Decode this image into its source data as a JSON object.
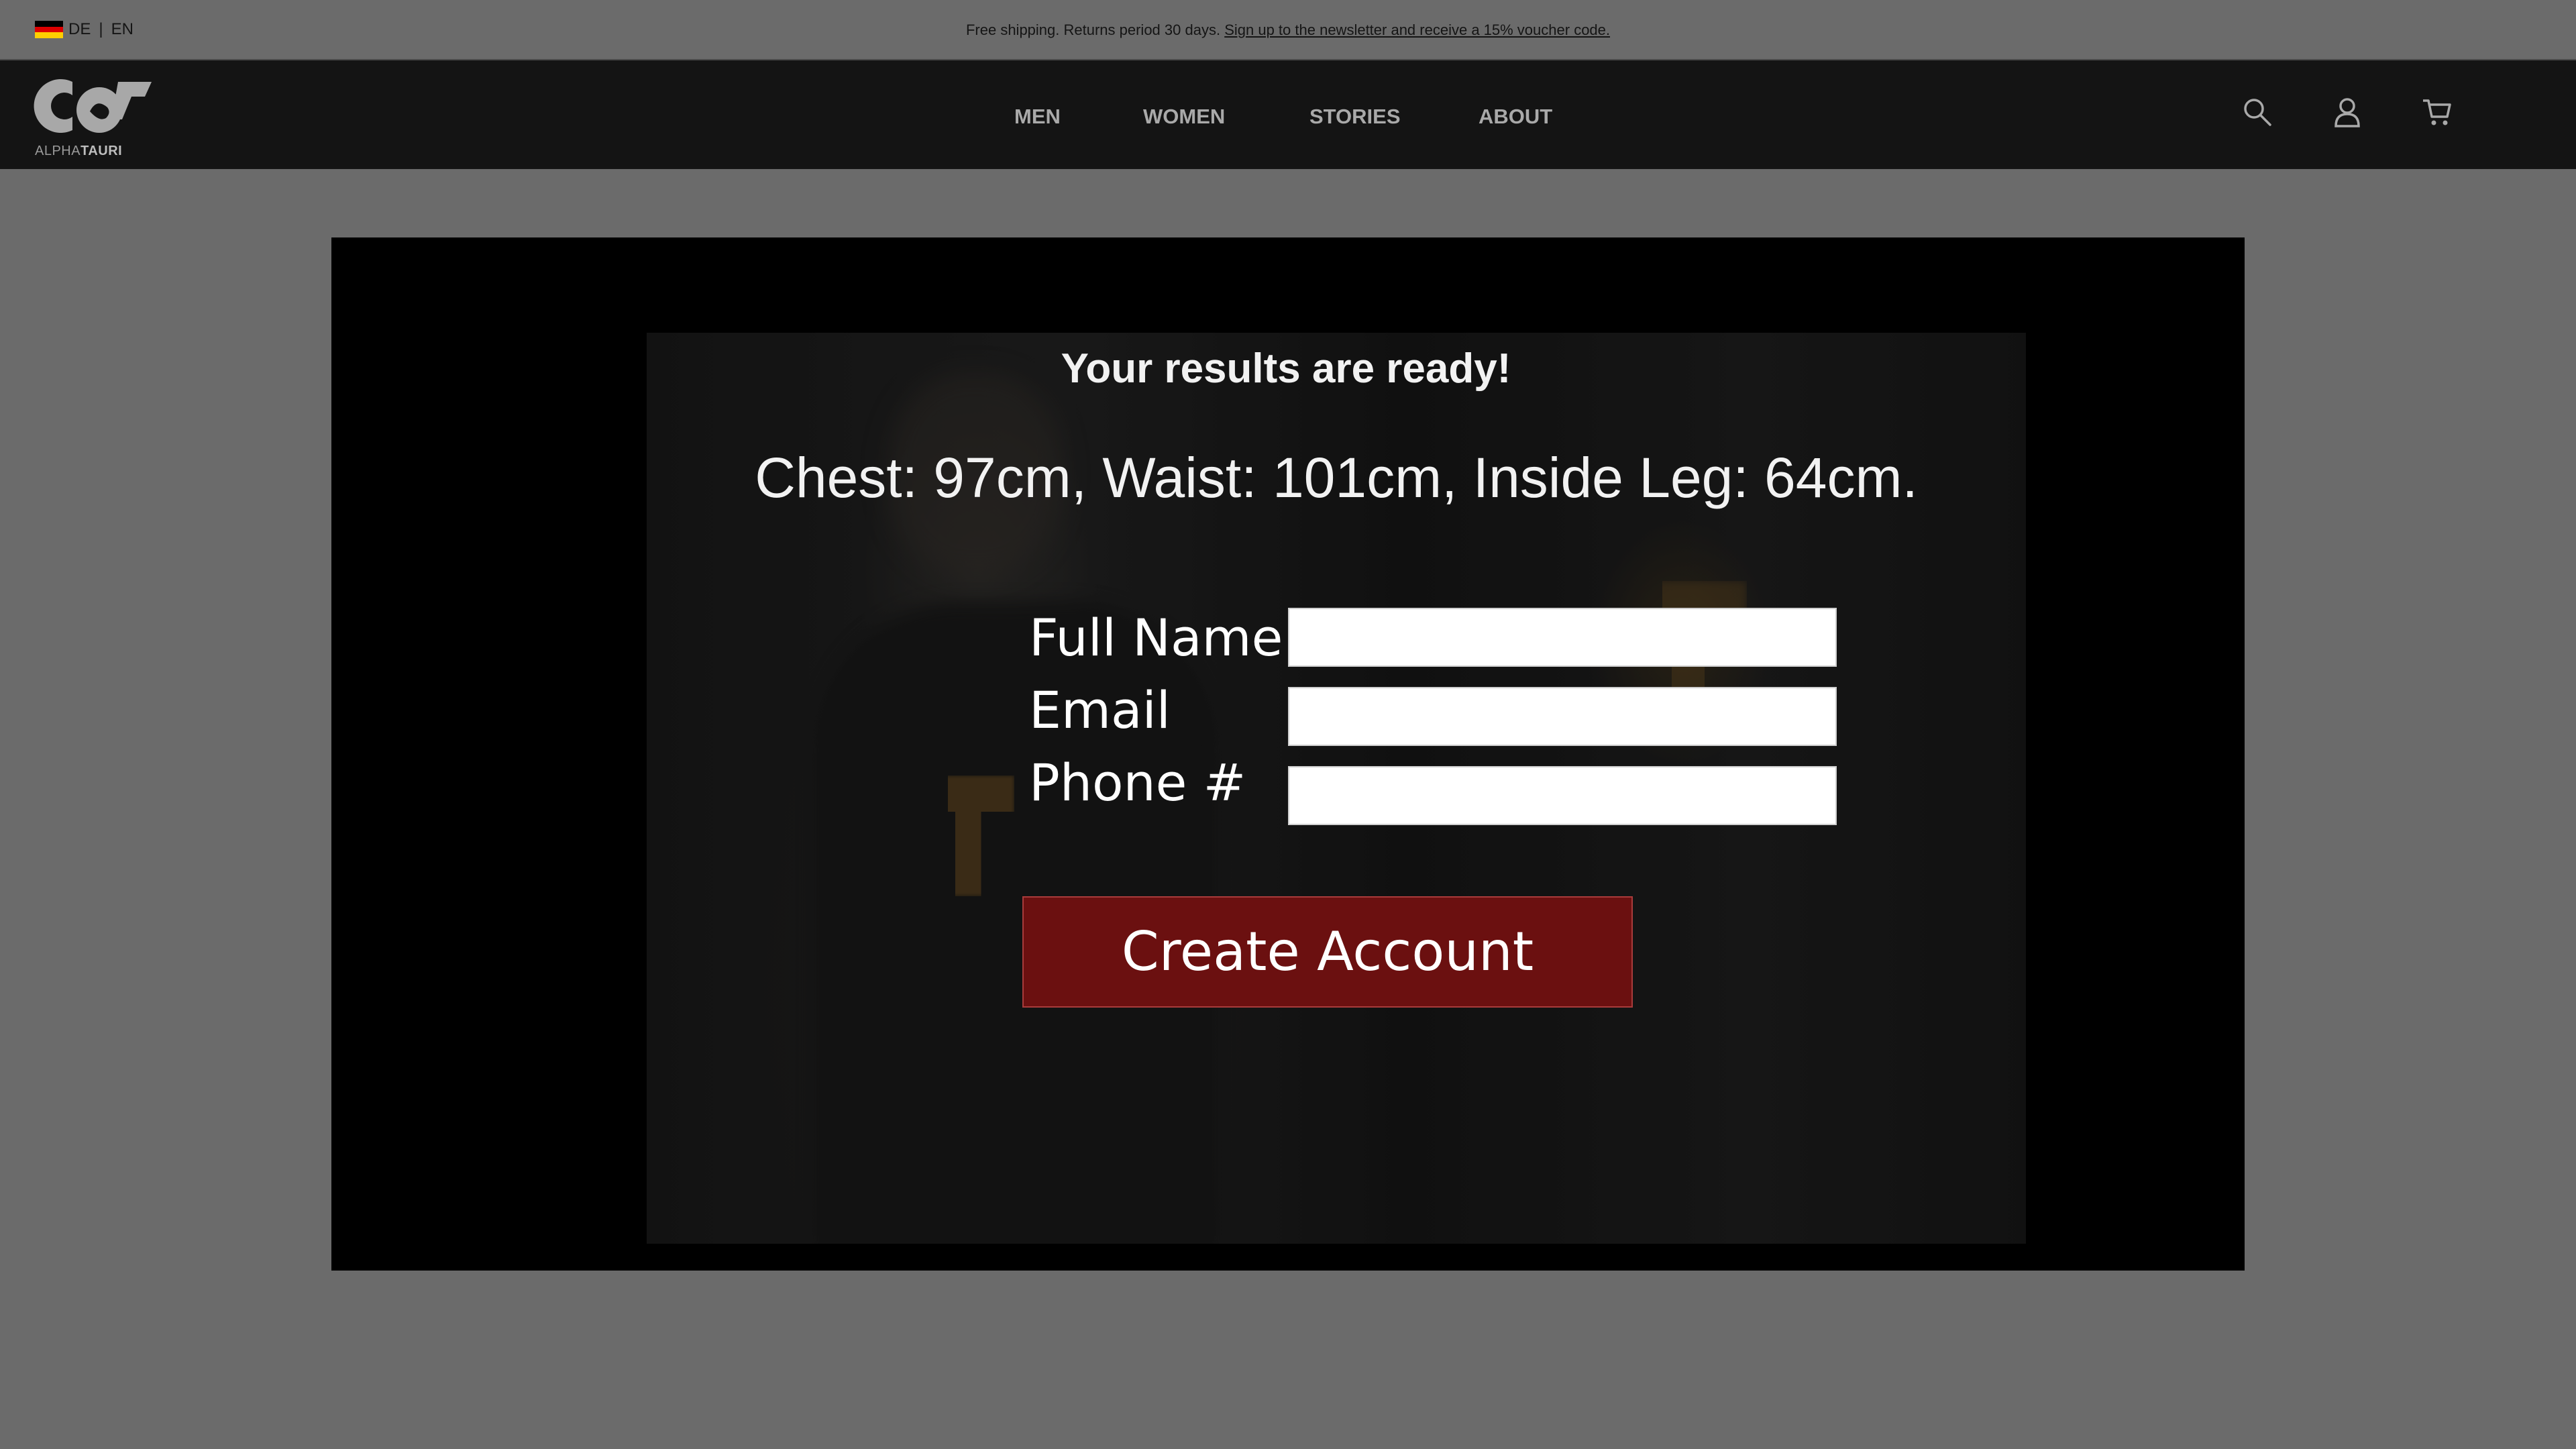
{
  "topbar": {
    "lang_de": "DE",
    "lang_sep": "|",
    "lang_en": "EN",
    "promo_text": "Free shipping. Returns period 30 days.",
    "promo_link": "Sign up to the newsletter and receive a 15% voucher code.",
    "flag_colors": [
      "#000000",
      "#dd0000",
      "#ffce00"
    ]
  },
  "header": {
    "logo_icon": "alphatauri-logo-icon",
    "logo_text_light": "ALPHA",
    "logo_text_bold": "TAURI",
    "nav": [
      {
        "label": "MEN"
      },
      {
        "label": "WOMEN"
      },
      {
        "label": "STORIES"
      },
      {
        "label": "ABOUT"
      }
    ],
    "icons": [
      "search-icon",
      "account-icon",
      "cart-icon"
    ]
  },
  "modal": {
    "title": "Your results are ready!",
    "measurements": "Chest: 97cm, Waist: 101cm, Inside Leg: 64cm.",
    "form": {
      "full_name_label": "Full Name",
      "full_name_value": "",
      "email_label": "Email",
      "email_value": "",
      "phone_label": "Phone #",
      "phone_value": ""
    },
    "submit_label": "Create Account",
    "button_color": "#6b1010"
  }
}
